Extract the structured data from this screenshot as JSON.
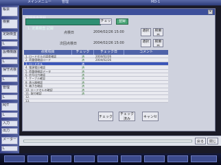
{
  "titlebar": {
    "title_left": "メインメニュー",
    "title_mid": "管理",
    "title_right": "MD-1"
  },
  "sidebar": {
    "items": [
      {
        "label": "帳票"
      },
      {
        "label": "検索"
      },
      {
        "label": "定期検査"
      },
      {
        "label": "L"
      },
      {
        "label": "設備機器"
      },
      {
        "label": "L"
      },
      {
        "label": "保守点検"
      },
      {
        "label": "L"
      },
      {
        "label": "管理"
      },
      {
        "label": "L"
      },
      {
        "label": "M/T"
      },
      {
        "label": "L"
      },
      {
        "label": "入力"
      },
      {
        "label": "出力"
      },
      {
        "label": "メーター"
      },
      {
        "label": "L"
      }
    ]
  },
  "window": {
    "title": "定期検査登録",
    "close_label": "×",
    "header_label": "1. 定期検査 記録",
    "tab_check_label": "チェック",
    "tab_active_label": "登録",
    "date_label_1": "点検日",
    "date_label_2": "次回点検日",
    "date_value_1": "2004/02/26  15:00",
    "date_value_2": "2004/02/26  15:00",
    "btn_a_1": "選択",
    "btn_b_1": "検索日",
    "btn_a_2": "選択",
    "btn_b_2": "検索日",
    "table": {
      "headers": [
        "点検項目",
        "チェック",
        "チェック日",
        "コメント"
      ],
      "rows": [
        {
          "item": "1. ロードセルの誤差確認",
          "status": "済",
          "date": "2004/02/26",
          "comment": ""
        },
        {
          "item": "2. 荷重値確認ロード",
          "status": "済",
          "date": "2004/02/26",
          "comment": ""
        },
        {
          "item": "3. ロードセル",
          "status": "済",
          "date": "",
          "comment": ""
        },
        {
          "item": "4. 電源電圧確認",
          "status": "済",
          "date": "",
          "comment": ""
        },
        {
          "item": "5. 荷重値確認データ",
          "status": "済",
          "date": "",
          "comment": ""
        },
        {
          "item": "6. 信号出力確認",
          "status": "済",
          "date": "",
          "comment": ""
        },
        {
          "item": "7. ケーブル確認",
          "status": "済",
          "date": "",
          "comment": ""
        },
        {
          "item": "8. 表示器確認",
          "status": "済",
          "date": "",
          "comment": ""
        },
        {
          "item": "9. 端子台確認",
          "status": "済",
          "date": "",
          "comment": ""
        },
        {
          "item": "10. ロードセルの確認",
          "status": "済",
          "date": "",
          "comment": ""
        },
        {
          "item": "11. 取付確認",
          "status": "済",
          "date": "",
          "comment": ""
        },
        {
          "item": "12.",
          "status": "",
          "date": "",
          "comment": ""
        },
        {
          "item": "13.",
          "status": "",
          "date": "",
          "comment": ""
        }
      ]
    },
    "btn_ok": "チェック",
    "btn_mid": "チェック済み",
    "btn_cancel": "キャンセル"
  },
  "bottom": {
    "field_label": "戻る",
    "btn_right": "閉じる"
  }
}
